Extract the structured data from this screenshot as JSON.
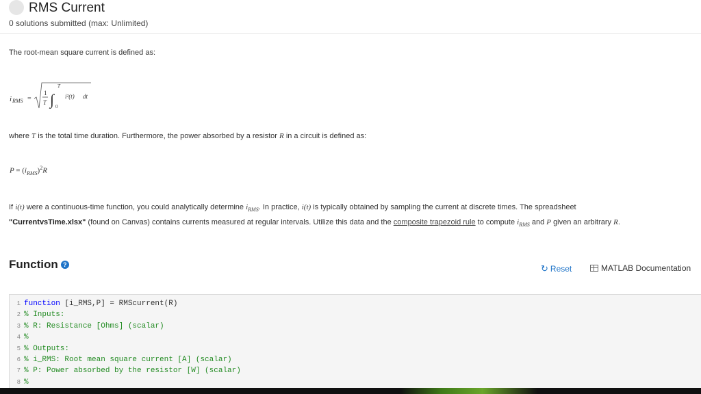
{
  "header": {
    "title": "RMS Current",
    "submissions": "0 solutions submitted (max: Unlimited)"
  },
  "problem": {
    "intro": "The root-mean square current is defined as:",
    "formula1": {
      "lhs": "i",
      "lhs_sub": "RMS",
      "eq": "=",
      "frac_num": "1",
      "frac_den": "T",
      "int_upper": "T",
      "int_lower": "0",
      "integrand": "i²(t)",
      "dt": "dt"
    },
    "where_pre": "where",
    "where_T": "T",
    "where_mid": "is the total time duration. Furthermore, the power absorbed by a resistor",
    "where_R": "R",
    "where_post": "in a circuit is defined as:",
    "formula2": {
      "P": "P",
      "eq": "=",
      "open": "(",
      "i": "i",
      "sub": "RMS",
      "close": ")",
      "sup": "2",
      "R": "R"
    },
    "para": {
      "p1": "If",
      "p1_math": "i(t)",
      "p2": "were a continuous-time function, you could analytically determine",
      "p2_math": "i",
      "p2_sub": "RMS",
      "p3": ". In practice,",
      "p3_math": "i(t)",
      "p4": "is typically obtained by sampling the current at discrete times. The spreadsheet",
      "bold": "\"CurrentvsTime.xlsx\"",
      "p5": "(found on Canvas) contains currents measured at regular intervals. Utilize this data and the",
      "link": "composite trapezoid rule",
      "p6": "to compute",
      "p6_math": "i",
      "p6_sub": "RMS",
      "p7": "and",
      "p7_math": "P",
      "p8": "given an arbitrary",
      "p8_math": "R",
      "p9": "."
    }
  },
  "function_section": {
    "heading": "Function",
    "help_icon": "?",
    "reset_label": "Reset",
    "doc_label": "MATLAB Documentation"
  },
  "code": {
    "lines": [
      {
        "n": "1",
        "kw": "function",
        "text": " [i_RMS,P] = RMScurrent(R)"
      },
      {
        "n": "2",
        "cm": "% Inputs:"
      },
      {
        "n": "3",
        "cm": "% R: Resistance [Ohms] (scalar)"
      },
      {
        "n": "4",
        "cm": "%"
      },
      {
        "n": "5",
        "cm": "% Outputs:"
      },
      {
        "n": "6",
        "cm": "% i_RMS: Root mean square current [A] (scalar)"
      },
      {
        "n": "7",
        "cm": "% P: Power absorbed by the resistor [W] (scalar)"
      },
      {
        "n": "8",
        "cm": "%"
      }
    ]
  },
  "icons": {
    "status": "status-circle-icon",
    "help": "question-circle-icon",
    "reset": "refresh-icon",
    "doc": "documentation-icon"
  },
  "colors": {
    "accent": "#1f74c8",
    "keyword": "#0000ff",
    "comment": "#228b22"
  }
}
